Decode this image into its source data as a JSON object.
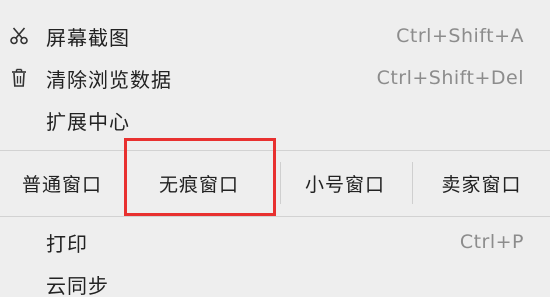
{
  "menu": {
    "items_top": [
      {
        "label": "屏幕截图",
        "shortcut": "Ctrl+Shift+A",
        "icon": "scissors-icon"
      },
      {
        "label": "清除浏览数据",
        "shortcut": "Ctrl+Shift+Del",
        "icon": "trash-icon"
      },
      {
        "label": "扩展中心",
        "shortcut": "",
        "icon": ""
      }
    ],
    "window_modes": [
      {
        "label": "普通窗口"
      },
      {
        "label": "无痕窗口"
      },
      {
        "label": "小号窗口"
      },
      {
        "label": "卖家窗口"
      }
    ],
    "items_bottom": [
      {
        "label": "打印",
        "shortcut": "Ctrl+P"
      },
      {
        "label": "云同步",
        "shortcut": ""
      }
    ]
  },
  "annotation": {
    "highlight_color": "#e8302f",
    "highlighted_item": "无痕窗口"
  }
}
